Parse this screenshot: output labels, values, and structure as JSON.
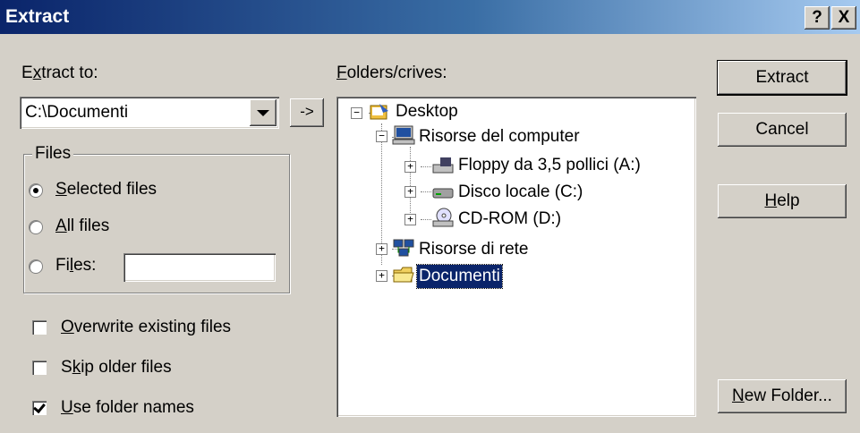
{
  "window": {
    "title": "Extract",
    "help_button": "?",
    "close_button": "X"
  },
  "extract_to": {
    "label_pre": "E",
    "label_ul": "x",
    "label_post": "tract to:",
    "value": "C:\\Documenti",
    "go_label": "->"
  },
  "files_group": {
    "legend": "Files",
    "selected": {
      "ul": "S",
      "rest": "elected files",
      "checked": true
    },
    "all": {
      "ul": "A",
      "rest": "ll files",
      "checked": false
    },
    "files": {
      "pre": "Fi",
      "ul": "l",
      "post": "es:",
      "checked": false,
      "value": ""
    }
  },
  "options": {
    "overwrite": {
      "ul": "O",
      "rest": "verwrite existing files",
      "checked": false
    },
    "skip": {
      "pre": "S",
      "ul": "k",
      "post": "ip older files",
      "checked": false
    },
    "folder_names": {
      "ul": "U",
      "rest": "se folder names",
      "checked": true
    }
  },
  "tree": {
    "label_ul": "F",
    "label_rest": "olders/crives:",
    "nodes": {
      "desktop": "Desktop",
      "computer": "Risorse del computer",
      "floppy": "Floppy da 3,5 pollici (A:)",
      "disk": "Disco locale (C:)",
      "cdrom": "CD-ROM (D:)",
      "network": "Risorse di rete",
      "docs": "Documenti"
    },
    "selected": "Documenti"
  },
  "buttons": {
    "extract": "Extract",
    "cancel": "Cancel",
    "help_ul": "H",
    "help_rest": "elp",
    "newfolder_ul": "N",
    "newfolder_rest": "ew Folder..."
  },
  "colors": {
    "titlebar": "#0a246a",
    "face": "#d4d0c8",
    "selection": "#0a246a"
  }
}
